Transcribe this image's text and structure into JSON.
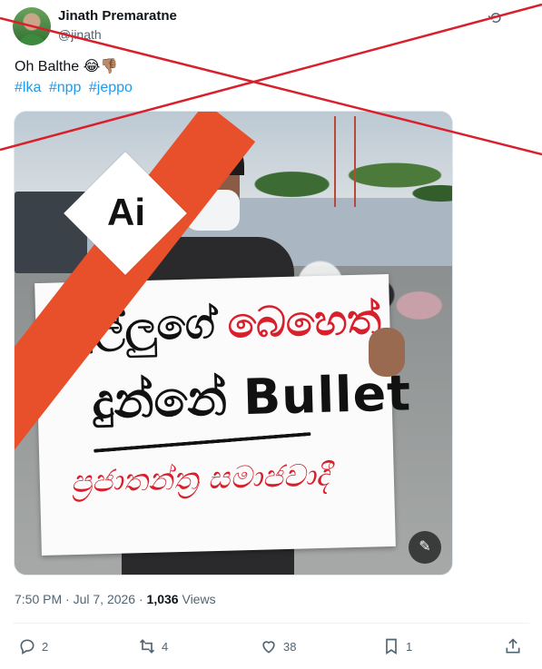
{
  "author": {
    "name": "Jinath Premaratne",
    "handle": "@jinath"
  },
  "tweet": {
    "text": "Oh Balthe 😂👎🏽",
    "hashtags": [
      "#lka",
      "#npp",
      "#jeppo"
    ]
  },
  "media": {
    "badge_text": "Ai",
    "placard": {
      "line1_black": "බුල්ලුගේ",
      "line1_red": "බෙහෙත්",
      "line2_sinhala": "දුන්නේ",
      "line2_english": "Bullet",
      "line3_red": "ප්‍රජාතන්ත්‍ර සමාජවාදී"
    },
    "alt_button_icon": "image-edit-icon"
  },
  "meta": {
    "time": "7:50 PM",
    "separator": " · ",
    "date": "Jul 7, 2026",
    "views_count": "1,036",
    "views_label": " Views"
  },
  "actions": {
    "replies": "2",
    "retweets": "4",
    "likes": "38",
    "bookmarks": "1"
  },
  "overlay": {
    "cross_color": "#d8202c"
  }
}
